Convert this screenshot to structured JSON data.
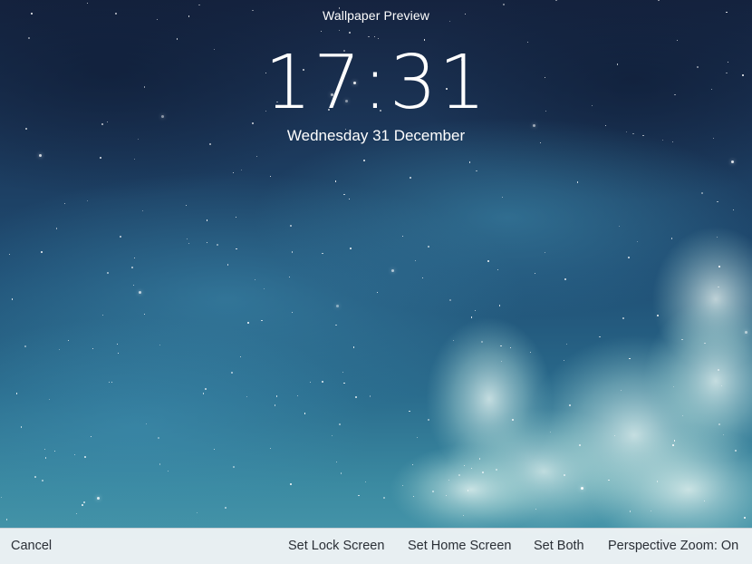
{
  "header": {
    "title": "Wallpaper Preview"
  },
  "lock_screen": {
    "time": "17:31",
    "date": "Wednesday 31 December"
  },
  "toolbar": {
    "cancel_label": "Cancel",
    "set_lock_label": "Set Lock Screen",
    "set_home_label": "Set Home Screen",
    "set_both_label": "Set Both",
    "perspective_zoom_label": "Perspective Zoom: On"
  },
  "colors": {
    "sky_top": "#15233f",
    "sky_bottom": "#4a9aad",
    "toolbar_bg": "#eef2f5",
    "toolbar_text": "#2a2f36"
  }
}
